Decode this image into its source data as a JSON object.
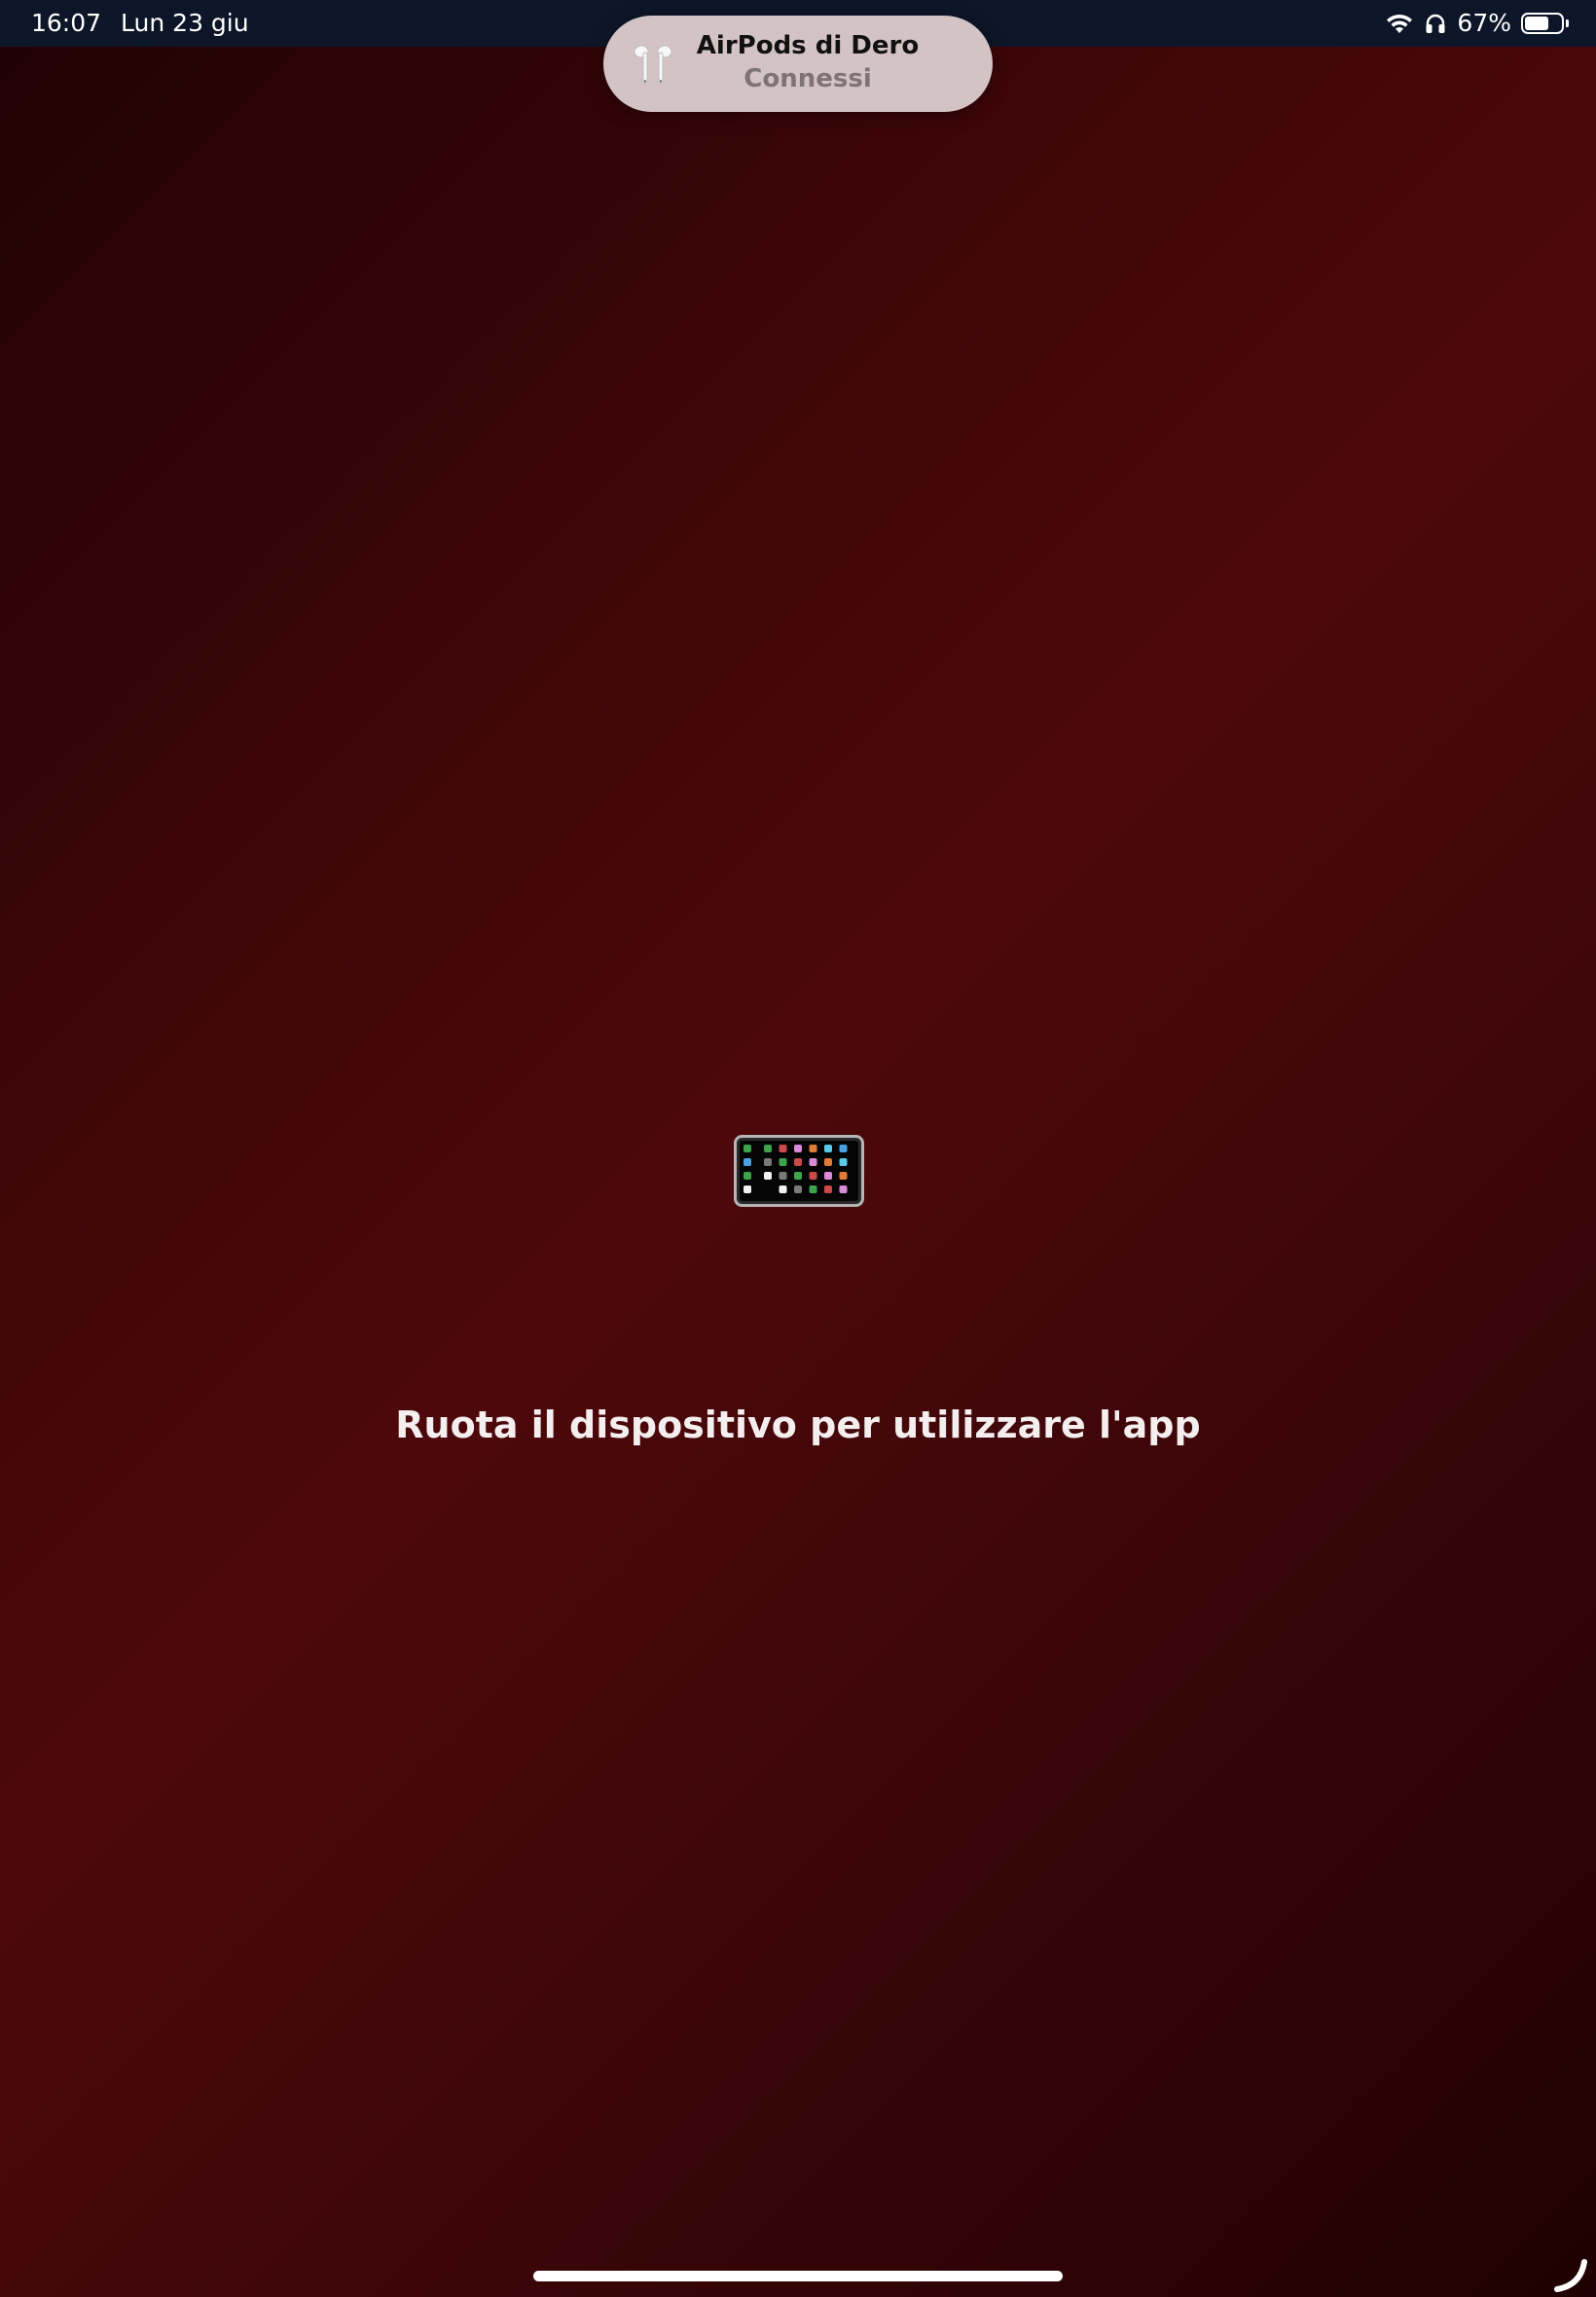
{
  "status_bar": {
    "time": "16:07",
    "date": "Lun 23 giu",
    "battery_percent_label": "67%",
    "battery_level": 0.67,
    "icons": [
      "wifi-icon",
      "headphones-icon",
      "battery-icon"
    ]
  },
  "notification": {
    "title": "AirPods di Dero",
    "subtitle": "Connessi",
    "icon": "airpods-icon"
  },
  "main": {
    "icon": "ipad-landscape-icon",
    "message": "Ruota il dispositivo per utilizzare l'app"
  },
  "colors": {
    "background_dark": "#1f0204",
    "background_red": "#4d080b",
    "status_bar": "#0d1628",
    "notification_bg": "#d3c3c5",
    "text": "#f4eeee"
  }
}
